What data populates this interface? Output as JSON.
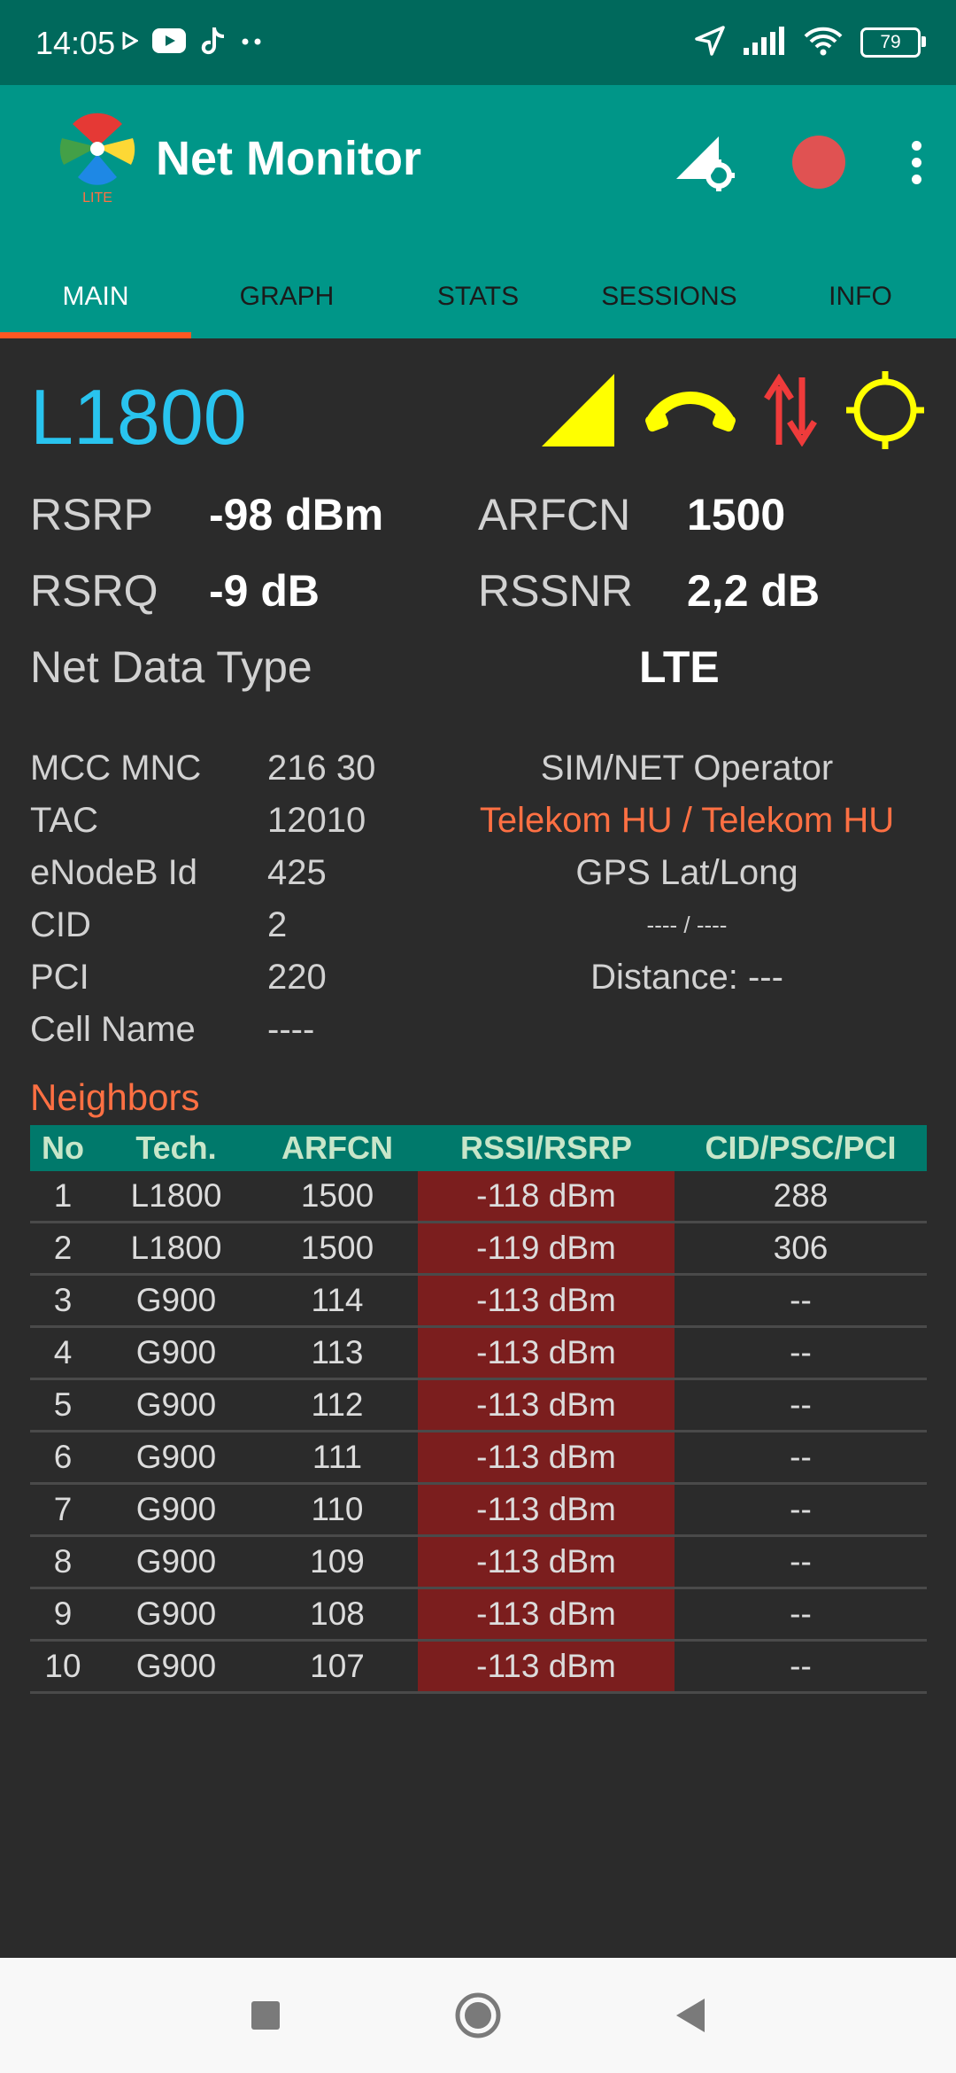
{
  "status_bar": {
    "time": "14:05",
    "battery": "79",
    "left_icons": [
      "play-arrow-icon",
      "youtube-icon",
      "tiktok-icon",
      "more-dots-icon"
    ],
    "right_icons": [
      "location-arrow-icon",
      "signal-bars-icon",
      "wifi-icon",
      "battery-icon"
    ]
  },
  "app_bar": {
    "title": "Net Monitor",
    "logo_badge": "LITE",
    "record_color": "#e05252"
  },
  "tabs": [
    "MAIN",
    "GRAPH",
    "STATS",
    "SESSIONS",
    "INFO"
  ],
  "active_tab": "MAIN",
  "main": {
    "tech_band": "L1800",
    "rsrp_label": "RSRP",
    "rsrp_value": "-98 dBm",
    "arfcn_label": "ARFCN",
    "arfcn_value": "1500",
    "rsrq_label": "RSRQ",
    "rsrq_value": "-9 dB",
    "rssnr_label": "RSSNR",
    "rssnr_value": "2,2 dB",
    "net_data_type_label": "Net Data Type",
    "net_data_type_value": "LTE"
  },
  "cell_info": {
    "rows": [
      {
        "label": "MCC MNC",
        "value": "216 30"
      },
      {
        "label": "TAC",
        "value": "12010"
      },
      {
        "label": "eNodeB Id",
        "value": "425"
      },
      {
        "label": "CID",
        "value": "2"
      },
      {
        "label": "PCI",
        "value": "220"
      },
      {
        "label": "Cell Name",
        "value": "----"
      }
    ],
    "operator_label": "SIM/NET Operator",
    "operator_value": "Telekom HU / Telekom HU",
    "gps_label": "GPS Lat/Long",
    "gps_value": "---- / ----",
    "distance": "Distance: ---"
  },
  "neighbors": {
    "title": "Neighbors",
    "headers": [
      "No",
      "Tech.",
      "ARFCN",
      "RSSI/RSRP",
      "CID/PSC/PCI"
    ],
    "rows": [
      {
        "no": "1",
        "tech": "L1800",
        "arfcn": "1500",
        "rssi": "-118 dBm",
        "cid": "288"
      },
      {
        "no": "2",
        "tech": "L1800",
        "arfcn": "1500",
        "rssi": "-119 dBm",
        "cid": "306"
      },
      {
        "no": "3",
        "tech": "G900",
        "arfcn": "114",
        "rssi": "-113 dBm",
        "cid": "--"
      },
      {
        "no": "4",
        "tech": "G900",
        "arfcn": "113",
        "rssi": "-113 dBm",
        "cid": "--"
      },
      {
        "no": "5",
        "tech": "G900",
        "arfcn": "112",
        "rssi": "-113 dBm",
        "cid": "--"
      },
      {
        "no": "6",
        "tech": "G900",
        "arfcn": "111",
        "rssi": "-113 dBm",
        "cid": "--"
      },
      {
        "no": "7",
        "tech": "G900",
        "arfcn": "110",
        "rssi": "-113 dBm",
        "cid": "--"
      },
      {
        "no": "8",
        "tech": "G900",
        "arfcn": "109",
        "rssi": "-113 dBm",
        "cid": "--"
      },
      {
        "no": "9",
        "tech": "G900",
        "arfcn": "108",
        "rssi": "-113 dBm",
        "cid": "--"
      },
      {
        "no": "10",
        "tech": "G900",
        "arfcn": "107",
        "rssi": "-113 dBm",
        "cid": "--"
      }
    ]
  },
  "nav_bar": {
    "buttons": [
      "recents-square-icon",
      "home-circle-icon",
      "back-triangle-icon"
    ]
  },
  "colors": {
    "app_bar": "#009688",
    "status_bar": "#00695c",
    "tab_indicator": "#ff5722",
    "lte_text": "#29c4ef",
    "gsm_text": "#ef4b4b",
    "rssi_cell_bg": "#7b1e1e",
    "operator_text": "#ff7043"
  }
}
